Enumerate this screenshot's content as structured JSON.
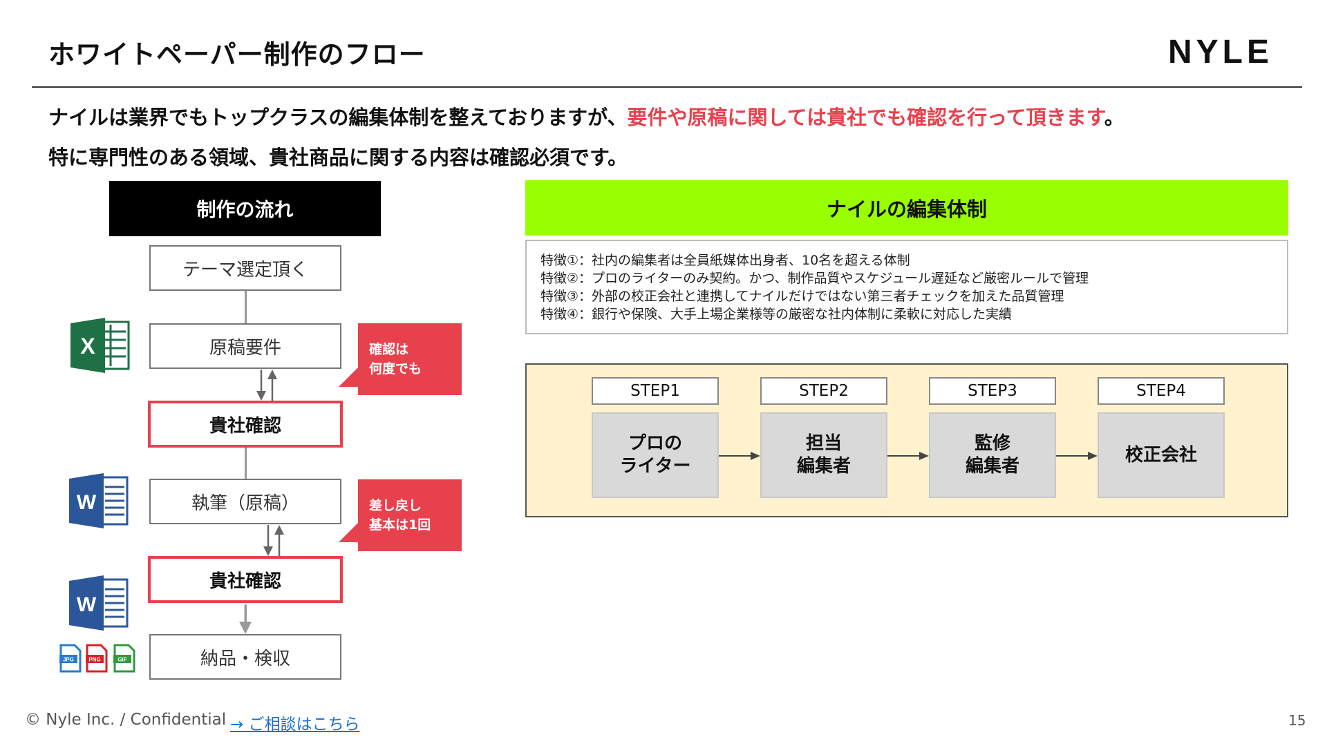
{
  "header": {
    "title": "ホワイトペーパー制作のフロー",
    "logo_text": "NYLE"
  },
  "intro": {
    "line1_normal": "ナイルは業界でもトップクラスの編集体制を整えておりますが、",
    "line1_highlight": "要件や原稿に関しては貴社でも確認を行って頂きます",
    "line1_end": "。",
    "line2": "特に専門性のある領域、貴社商品に関する内容は確認必須です。",
    "highlight_color": "#e8414e"
  },
  "flow": {
    "header": "制作の流れ",
    "steps": [
      {
        "label": "テーマ選定頂く"
      },
      {
        "label": "原稿要件",
        "icon": "excel-icon"
      },
      {
        "label": "貴社確認",
        "client_check": true
      },
      {
        "label": "執筆（原稿）",
        "icon": "word-icon"
      },
      {
        "label": "貴社確認",
        "client_check": true,
        "icon": "word-icon"
      },
      {
        "label": "納品・検収",
        "icons": [
          "jpg-file-icon",
          "png-file-icon",
          "gif-file-icon"
        ]
      }
    ],
    "callouts": [
      {
        "line1": "確認は",
        "line2": "何度でも"
      },
      {
        "line1": "差し戻し",
        "line2": "基本は1回"
      }
    ],
    "icon_letters": {
      "excel": "X",
      "word": "W",
      "jpg": "JPG",
      "png": "PNG",
      "gif": "GIF"
    },
    "accent_color": "#e8414e"
  },
  "editorial": {
    "header": "ナイルの編集体制",
    "header_color": "#99ff00",
    "features": [
      "特徴①：社内の編集者は全員紙媒体出身者、10名を超える体制",
      "特徴②：プロのライターのみ契約。かつ、制作品質やスケジュール遅延など厳密ルールで管理",
      "特徴③：外部の校正会社と連携してナイルだけではない第三者チェックを加えた品質管理",
      "特徴④：銀行や保険、大手上場企業様等の厳密な社内体制に柔軟に対応した実績"
    ],
    "steps": [
      {
        "label": "STEP1",
        "line1": "プロの",
        "line2": "ライター"
      },
      {
        "label": "STEP2",
        "line1": "担当",
        "line2": "編集者"
      },
      {
        "label": "STEP3",
        "line1": "監修",
        "line2": "編集者"
      },
      {
        "label": "STEP4",
        "line1": "校正会社",
        "line2": ""
      }
    ],
    "panel_color": "#fff2cc"
  },
  "footer": {
    "copyright": "© Nyle Inc. / Confidential",
    "consult_link": "→ ご相談はこちら",
    "page_number": "15"
  }
}
